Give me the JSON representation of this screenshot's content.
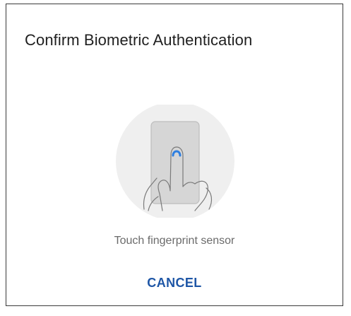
{
  "dialog": {
    "title": "Confirm Biometric Authentication",
    "illustration_icon": "fingerprint-touch-icon",
    "instruction": "Touch fingerprint sensor",
    "cancel_label": "CANCEL"
  },
  "colors": {
    "accent": "#1e56a6",
    "sensor_dot": "#2f7fe0",
    "illustration_bg": "#efefef",
    "title": "#1f1f1f",
    "instruction": "#6b6b6b",
    "border": "#3a3a3a"
  }
}
